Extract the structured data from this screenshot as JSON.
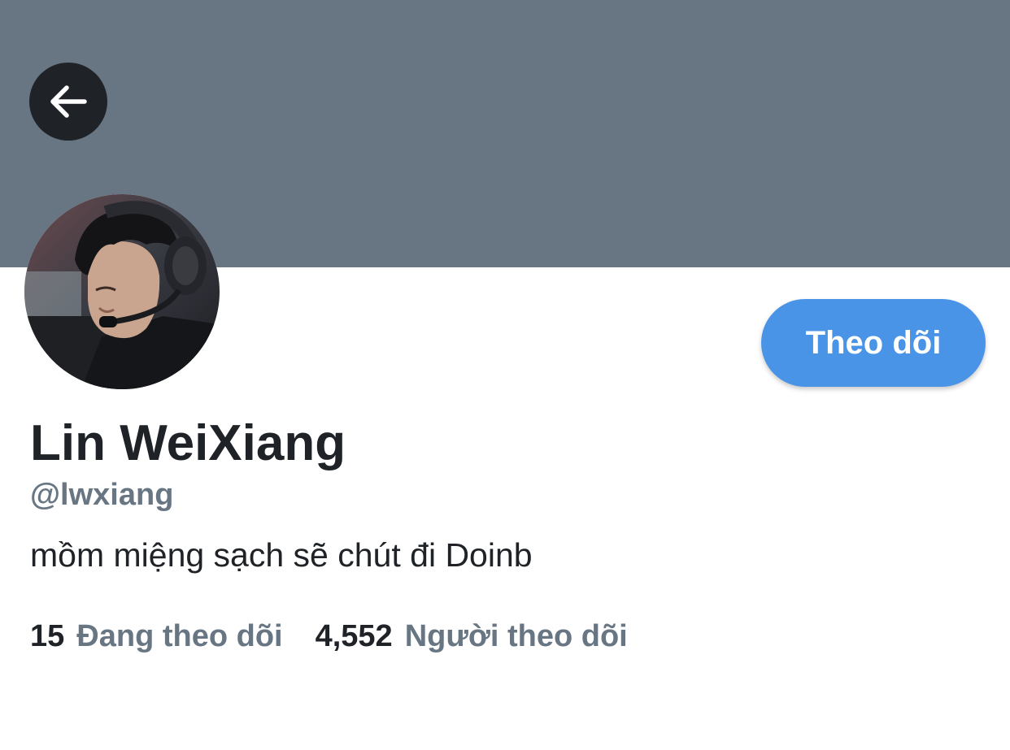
{
  "header": {
    "back_icon": "arrow-left-icon",
    "banner_color": "#687684"
  },
  "profile": {
    "display_name": "Lin WeiXiang",
    "handle": "@lwxiang",
    "bio": "mồm miệng sạch sẽ chút đi Doinb",
    "avatar": "profile-photo"
  },
  "actions": {
    "follow_label": "Theo dõi",
    "follow_color": "#4a94e8"
  },
  "stats": {
    "following_count": "15",
    "following_label": "Đang theo dõi",
    "followers_count": "4,552",
    "followers_label": "Người theo dõi"
  },
  "colors": {
    "text_primary": "#1f2327",
    "text_secondary": "#687684"
  }
}
